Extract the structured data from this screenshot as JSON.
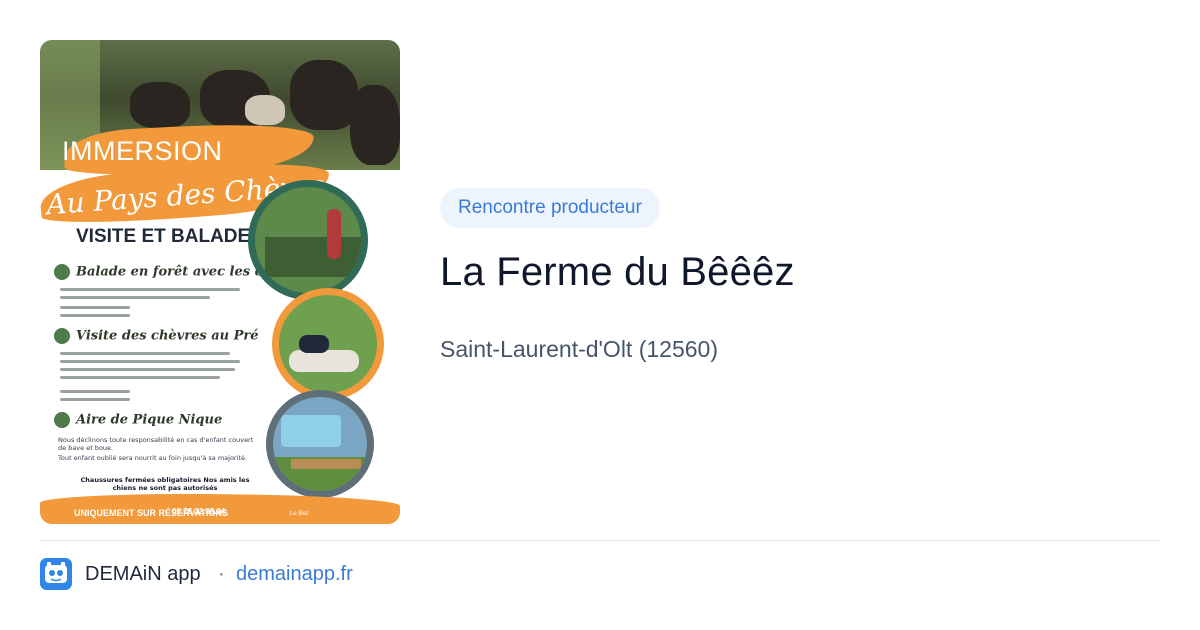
{
  "poster": {
    "title": "IMMERSION",
    "script_title": "Au Pays des Chèvres",
    "subtitle": "VISITE ET BALADE",
    "section_1": "Balade en forêt avec les chèvres",
    "section_2": "Visite des chèvres au Pré",
    "section_3": "Aire de Pique Nique",
    "note_1": "Nous déclinons toute responsabilité en cas d'enfant couvert de bave et boue.",
    "note_2": "Tout enfant oublié sera nourrit au foin jusqu'à sa majorité.",
    "rule": "Chaussures fermées obligatoires Nos amis les chiens ne sont pas autorisés",
    "cta": "UNIQUEMENT SUR RÉSERVATIONS",
    "phone": "06.78.32.88.34",
    "address": "Le Bez"
  },
  "card": {
    "category": "Rencontre producteur",
    "title": "La Ferme du Bêêêz",
    "location": "Saint-Laurent-d'Olt (12560)"
  },
  "footer": {
    "app_name": "DEMAiN app",
    "separator": "·",
    "domain": "demainapp.fr"
  },
  "colors": {
    "accent": "#3a7bd5",
    "badge_bg": "#eef4fc",
    "poster_orange": "#f2993b",
    "title_text": "#0f172a",
    "secondary_text": "#475569"
  },
  "icons": {
    "logo": "demain-app-logo-icon"
  }
}
